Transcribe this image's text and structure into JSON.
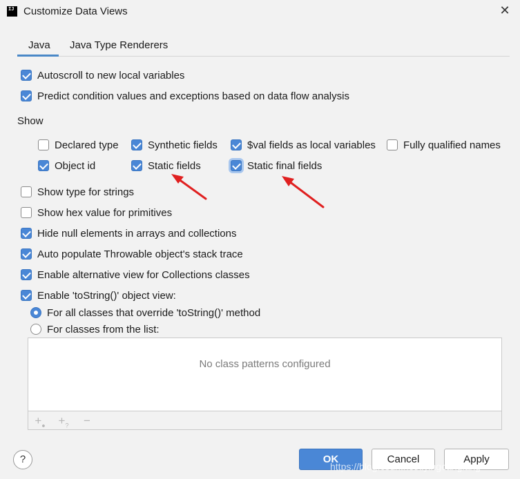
{
  "window": {
    "title": "Customize Data Views",
    "close_glyph": "✕"
  },
  "tabs": [
    {
      "label": "Java",
      "selected": true
    },
    {
      "label": "Java Type Renderers",
      "selected": false
    }
  ],
  "top_options": [
    {
      "label": "Autoscroll to new local variables",
      "checked": true
    },
    {
      "label": "Predict condition values and exceptions based on data flow analysis",
      "checked": true
    }
  ],
  "show": {
    "title": "Show",
    "items": [
      {
        "label": "Declared type",
        "checked": false
      },
      {
        "label": "Synthetic fields",
        "checked": true
      },
      {
        "label": "$val fields as local variables",
        "checked": true
      },
      {
        "label": "Fully qualified names",
        "checked": false
      },
      {
        "label": "Object id",
        "checked": true
      },
      {
        "label": "Static fields",
        "checked": true
      },
      {
        "label": "Static final fields",
        "checked": true,
        "focused": true
      }
    ]
  },
  "options": [
    {
      "label": "Show type for strings",
      "checked": false
    },
    {
      "label": "Show hex value for primitives",
      "checked": false
    },
    {
      "label": "Hide null elements in arrays and collections",
      "checked": true
    },
    {
      "label": "Auto populate Throwable object's stack trace",
      "checked": true
    },
    {
      "label": "Enable alternative view for Collections classes",
      "checked": true
    },
    {
      "label": "Enable 'toString()' object view:",
      "checked": true
    }
  ],
  "tostring_scope": [
    {
      "label": "For all classes that override 'toString()' method",
      "selected": true
    },
    {
      "label": "For classes from the list:",
      "selected": false
    }
  ],
  "class_list": {
    "empty_text": "No class patterns configured"
  },
  "list_toolbar": {
    "add_icon": "+",
    "add_pattern_icon": "+",
    "remove_icon": "−"
  },
  "buttons": {
    "help": "?",
    "ok": "OK",
    "cancel": "Cancel",
    "apply": "Apply"
  },
  "watermark": "https://blog.csdn.net/liyingcanglang",
  "colors": {
    "accent": "#4a87d6",
    "annotation_arrow": "#e02020"
  }
}
